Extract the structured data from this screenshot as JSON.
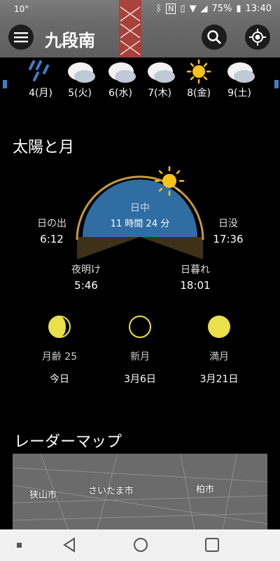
{
  "status": {
    "left_temp": "10°",
    "battery": "75%",
    "time": "13:40",
    "icons": [
      "bluetooth-icon",
      "nfc-icon",
      "vibrate-icon",
      "wifi-icon",
      "signal-icon",
      "battery-icon"
    ]
  },
  "header": {
    "location": "九段南",
    "menu_icon": "hamburger-menu-icon",
    "search_icon": "search-icon",
    "locate_icon": "gps-locate-icon"
  },
  "forecast": {
    "days": [
      {
        "label": "4(月)",
        "icon": "rain-icon"
      },
      {
        "label": "5(火)",
        "icon": "cloud-icon"
      },
      {
        "label": "6(水)",
        "icon": "cloud-icon"
      },
      {
        "label": "7(木)",
        "icon": "cloud-icon"
      },
      {
        "label": "8(金)",
        "icon": "sun-icon"
      },
      {
        "label": "9(土)",
        "icon": "cloud-icon"
      }
    ]
  },
  "sun_moon": {
    "title": "太陽と月",
    "daylight_label": "日中",
    "daylight_duration": "11 時間 24 分",
    "sunrise_label": "日の出",
    "sunrise_time": "6:12",
    "sunset_label": "日没",
    "sunset_time": "17:36",
    "dawn_label": "夜明け",
    "dawn_time": "5:46",
    "dusk_label": "日暮れ",
    "dusk_time": "18:01",
    "colors": {
      "day": "#2f6da3",
      "twilight": "#3d3118",
      "arc": "#c49a3c",
      "sun": "#f7c21a",
      "moon": "#e9e04a"
    }
  },
  "moon": {
    "phases": [
      {
        "name": "月齢 25",
        "date": "今日",
        "icon": "waning-moon-icon"
      },
      {
        "name": "新月",
        "date": "3月6日",
        "icon": "new-moon-icon"
      },
      {
        "name": "満月",
        "date": "3月21日",
        "icon": "full-moon-icon"
      }
    ]
  },
  "radar": {
    "title": "レーダーマップ",
    "labels": [
      "狭山市",
      "さいたま市",
      "柏市"
    ]
  },
  "navbar": {
    "icons": [
      "recent-dot-icon",
      "back-icon",
      "home-icon",
      "overview-icon"
    ]
  }
}
